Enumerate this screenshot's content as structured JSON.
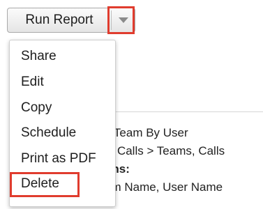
{
  "toolbar": {
    "run_report_label": "Run Report",
    "dropdown_icon": "chevron-down-icon"
  },
  "dropdown": {
    "items": [
      {
        "label": "Share"
      },
      {
        "label": "Edit"
      },
      {
        "label": "Copy"
      },
      {
        "label": "Schedule"
      },
      {
        "label": "Print as PDF"
      },
      {
        "label": "Delete"
      }
    ]
  },
  "report_details": {
    "line1": "y Team By User",
    "line2": "s, Calls > Teams, Calls",
    "line3": "nns:",
    "line4": "am Name, User Name"
  },
  "colors": {
    "highlight": "#e03c2e"
  }
}
